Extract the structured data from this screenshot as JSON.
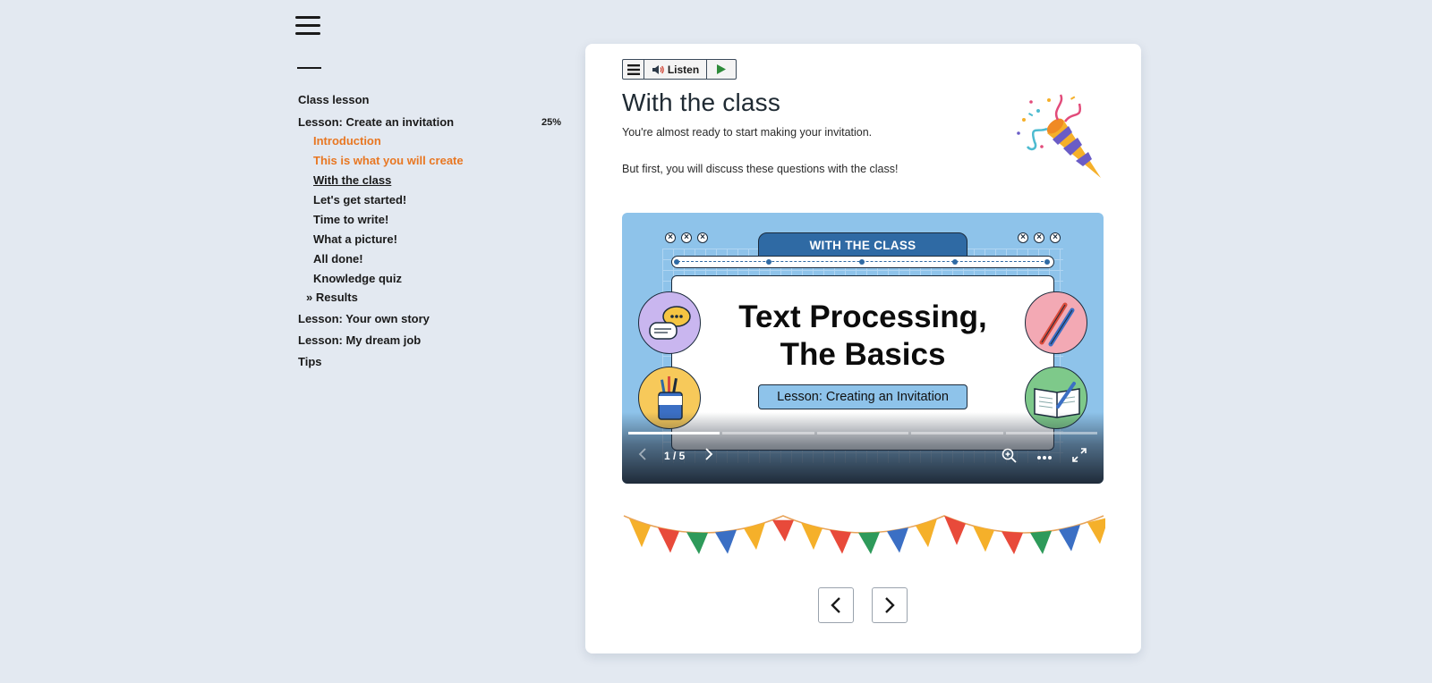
{
  "sidebar": {
    "items": [
      {
        "label": "Class lesson"
      },
      {
        "label": "Lesson: Create an invitation",
        "progress": "25%"
      },
      {
        "label": "Lesson: Your own story"
      },
      {
        "label": "Lesson: My dream job"
      },
      {
        "label": "Tips"
      }
    ],
    "subitems": [
      {
        "label": "Introduction",
        "state": "visited"
      },
      {
        "label": "This is what you will create",
        "state": "visited"
      },
      {
        "label": "With the class",
        "state": "current"
      },
      {
        "label": "Let's get started!",
        "state": "default"
      },
      {
        "label": "Time to write!",
        "state": "default"
      },
      {
        "label": "What a picture!",
        "state": "default"
      },
      {
        "label": "All done!",
        "state": "default"
      },
      {
        "label": "Knowledge quiz",
        "state": "default"
      }
    ],
    "results_label": "» Results"
  },
  "toolbar": {
    "listen_label": "Listen"
  },
  "content": {
    "title": "With the class",
    "paragraph1": "You're almost ready to start making your invitation.",
    "paragraph2": "But first, you will discuss these questions with the class!"
  },
  "slide": {
    "tag": "WITH THE CLASS",
    "heading_line1": "Text Processing,",
    "heading_line2": "The Basics",
    "subtitle": "Lesson: Creating an Invitation",
    "counter": "1 / 5",
    "current": 1,
    "total": 5
  },
  "colors": {
    "background": "#e3e9f1",
    "visited": "#e87722",
    "slide_bg": "#8ec3ea",
    "slide_tag": "#2f6aa4"
  }
}
